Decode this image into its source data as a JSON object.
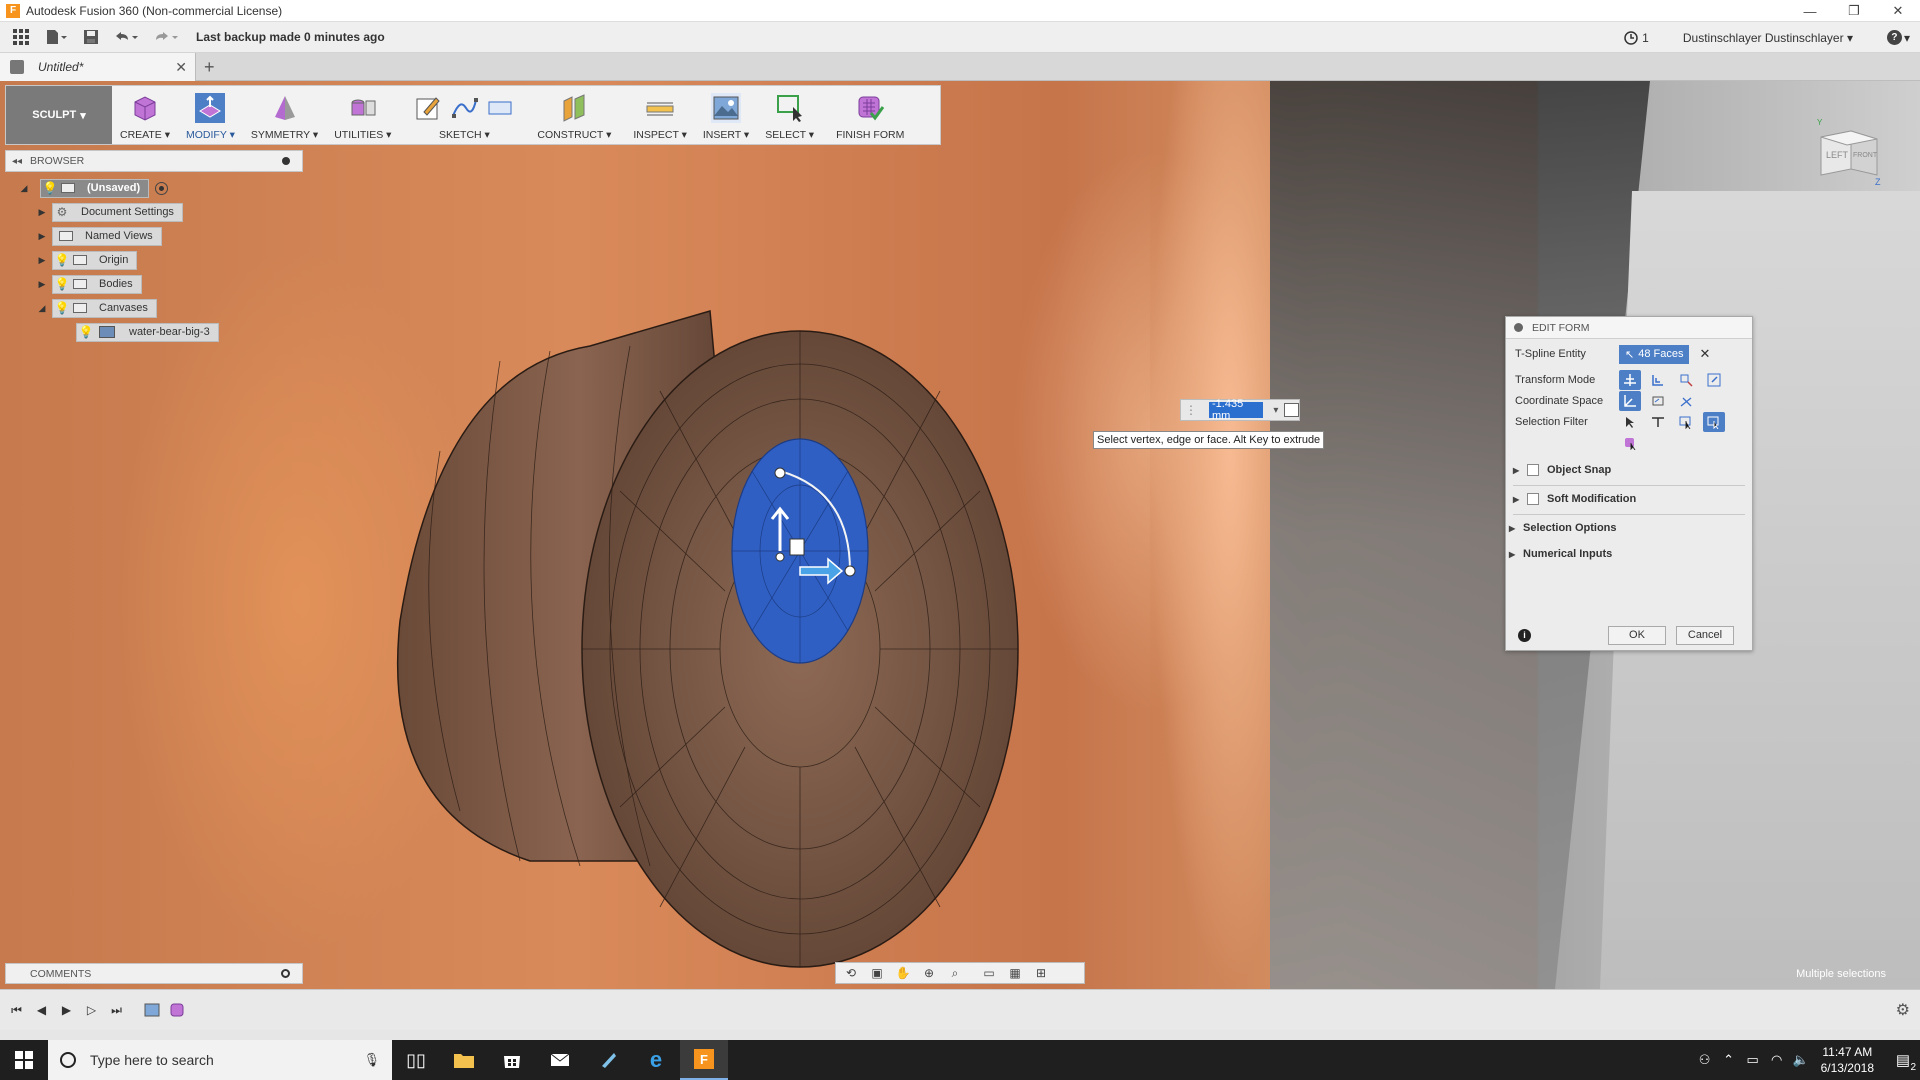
{
  "window": {
    "title": "Autodesk Fusion 360 (Non-commercial License)",
    "app_icon": "F",
    "minimize": "—",
    "restore": "❐",
    "close": "✕"
  },
  "quick_access": {
    "backup_status": "Last backup made 0 minutes ago",
    "job_status_count": "1",
    "user": "Dustinschlayer Dustinschlayer",
    "help": "?"
  },
  "doc_tabs": {
    "active_label": "Untitled*",
    "close_glyph": "✕",
    "add_glyph": "+"
  },
  "toolbar": {
    "workspace": "SCULPT",
    "groups": [
      {
        "label": "CREATE"
      },
      {
        "label": "MODIFY"
      },
      {
        "label": "SYMMETRY"
      },
      {
        "label": "UTILITIES"
      },
      {
        "label": "SKETCH"
      },
      {
        "label": "CONSTRUCT"
      },
      {
        "label": "INSPECT"
      },
      {
        "label": "INSERT"
      },
      {
        "label": "SELECT"
      },
      {
        "label": "FINISH FORM"
      }
    ]
  },
  "browser": {
    "title": "BROWSER",
    "items": [
      {
        "label": "(Unsaved)"
      },
      {
        "label": "Document Settings"
      },
      {
        "label": "Named Views"
      },
      {
        "label": "Origin"
      },
      {
        "label": "Bodies"
      },
      {
        "label": "Canvases"
      },
      {
        "label": "water-bear-big-3"
      }
    ]
  },
  "value_input": {
    "value": "-1.435 mm"
  },
  "tooltip": {
    "text": "Select vertex, edge or face. Alt Key to extrude"
  },
  "edit_form": {
    "title": "EDIT FORM",
    "tspline_label": "T-Spline Entity",
    "tspline_value": "48 Faces",
    "transform_mode_label": "Transform Mode",
    "coordinate_space_label": "Coordinate Space",
    "selection_filter_label": "Selection Filter",
    "object_snap": "Object Snap",
    "soft_modification": "Soft Modification",
    "selection_options": "Selection Options",
    "numerical_inputs": "Numerical Inputs",
    "ok": "OK",
    "cancel": "Cancel",
    "remove_glyph": "✕",
    "info_glyph": "i"
  },
  "view_cube": {
    "left": "LEFT",
    "front": "FRONT",
    "axis_y": "Y",
    "axis_z": "Z"
  },
  "comments": {
    "title": "COMMENTS"
  },
  "status": {
    "multi_selection": "Multiple selections"
  },
  "taskbar": {
    "search_placeholder": "Type here to search",
    "time": "11:47 AM",
    "date": "6/13/2018",
    "notification_count": "2"
  },
  "colors": {
    "accent": "#4d7fc6",
    "selection_blue": "#2b5fb8",
    "model_brown": "#6e4e3c"
  }
}
